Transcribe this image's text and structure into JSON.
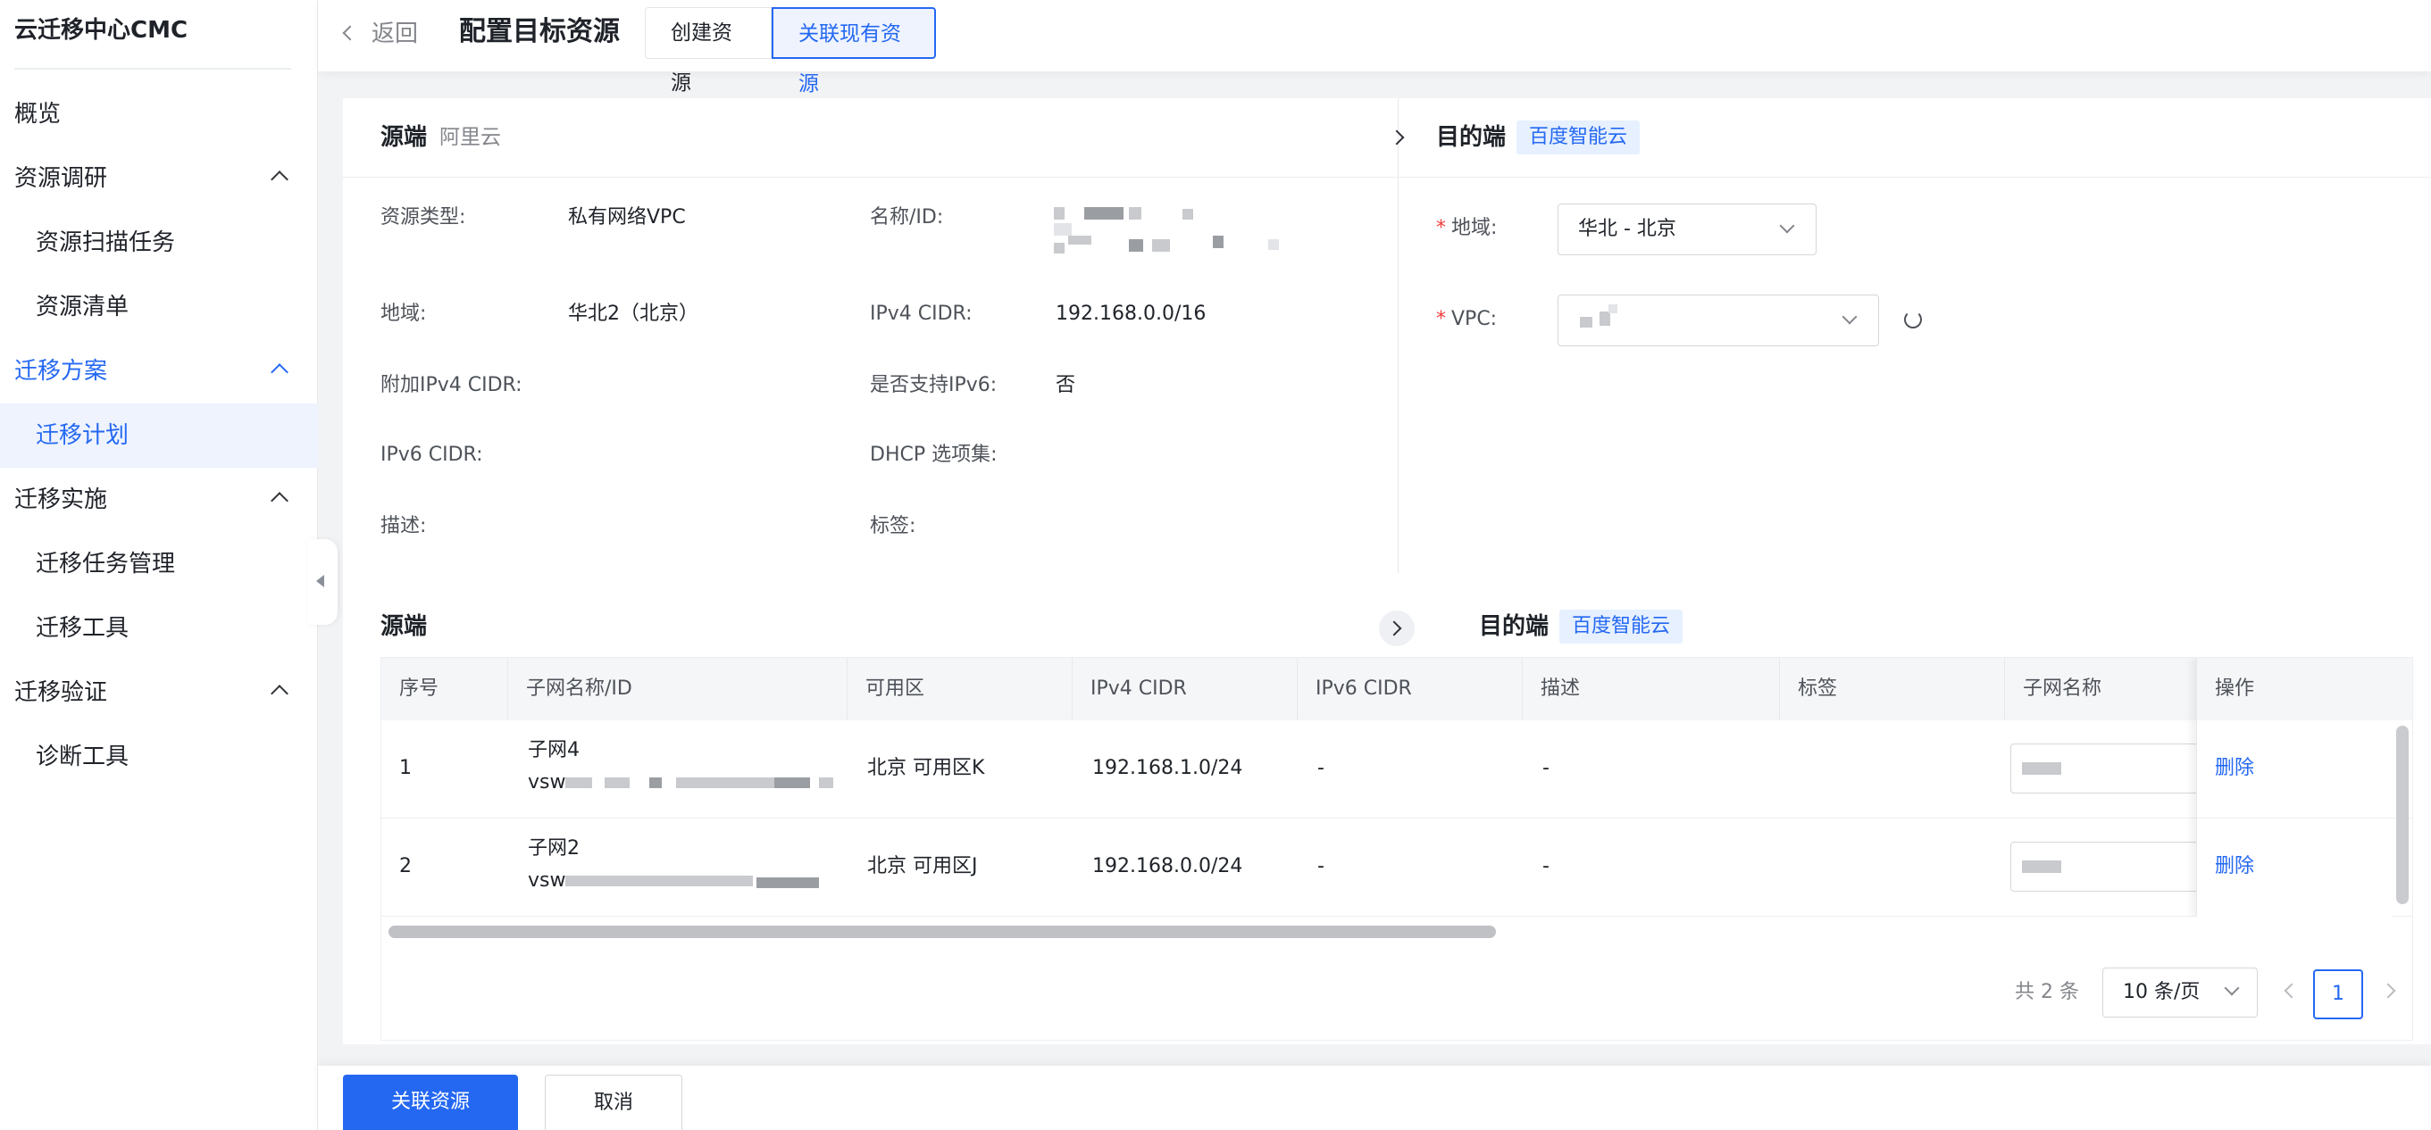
{
  "sidebar": {
    "brand": "云迁移中心CMC",
    "items": [
      {
        "label": "概览"
      },
      {
        "label": "资源调研"
      },
      {
        "label": "资源扫描任务"
      },
      {
        "label": "资源清单"
      },
      {
        "label": "迁移方案"
      },
      {
        "label": "迁移计划"
      },
      {
        "label": "迁移实施"
      },
      {
        "label": "迁移任务管理"
      },
      {
        "label": "迁移工具"
      },
      {
        "label": "迁移验证"
      },
      {
        "label": "诊断工具"
      }
    ]
  },
  "header": {
    "back_label": "返回",
    "title": "配置目标资源",
    "tab_create": "创建资源",
    "tab_link": "关联现有资源"
  },
  "source": {
    "title": "源端",
    "provider": "阿里云",
    "labels": {
      "type": "资源类型:",
      "name": "名称/ID:",
      "region": "地域:",
      "ipv4": "IPv4 CIDR:",
      "extra_ipv4": "附加IPv4 CIDR:",
      "ipv6_support": "是否支持IPv6:",
      "ipv6": "IPv6 CIDR:",
      "dhcp": "DHCP 选项集:",
      "desc": "描述:",
      "tags": "标签:"
    },
    "values": {
      "type": "私有网络VPC",
      "region": "华北2（北京）",
      "ipv4": "192.168.0.0/16",
      "ipv6_support": "否"
    }
  },
  "target": {
    "title": "目的端",
    "provider": "百度智能云",
    "region_label": "地域:",
    "region_value": "华北 - 北京",
    "vpc_label": "VPC:",
    "required_mark": "*"
  },
  "subnets": {
    "source_title": "源端",
    "target_title": "目的端",
    "target_provider": "百度智能云",
    "columns": [
      "序号",
      "子网名称/ID",
      "可用区",
      "IPv4 CIDR",
      "IPv6 CIDR",
      "描述",
      "标签",
      "子网名称",
      "操作"
    ],
    "rows": [
      {
        "index": "1",
        "name": "子网4",
        "id_prefix": "vsw",
        "zone": "北京 可用区K",
        "ipv4": "192.168.1.0/24",
        "ipv6": "-",
        "desc": "-",
        "action": "删除"
      },
      {
        "index": "2",
        "name": "子网2",
        "id_prefix": "vsw",
        "zone": "北京 可用区J",
        "ipv4": "192.168.0.0/24",
        "ipv6": "-",
        "desc": "-",
        "action": "删除"
      }
    ]
  },
  "pagination": {
    "total": "共 2 条",
    "page_size": "10 条/页",
    "current_page": "1"
  },
  "footer": {
    "primary": "关联资源",
    "cancel": "取消"
  },
  "colors": {
    "accent": "#2468f2",
    "tag_bg": "#e6f0ff",
    "required": "#f33e3e"
  }
}
